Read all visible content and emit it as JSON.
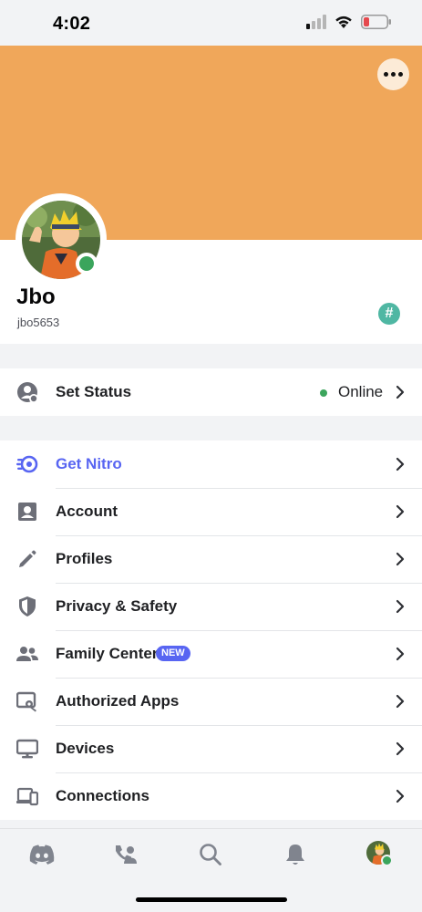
{
  "status_bar": {
    "time": "4:02",
    "icons": [
      "signal-icon",
      "wifi-icon",
      "battery-low-icon"
    ]
  },
  "profile": {
    "banner_color": "#f0a75a",
    "display_name": "Jbo",
    "username": "jbo5653",
    "status_color": "#3ba55c",
    "badge_text": "#",
    "badge_color": "#4fb7a3"
  },
  "status_section": {
    "label": "Set Status",
    "value": "Online",
    "icon": "user-status-icon"
  },
  "settings": [
    {
      "label": "Get Nitro",
      "icon": "nitro-icon",
      "accent": "#5865f2"
    },
    {
      "label": "Account",
      "icon": "account-icon"
    },
    {
      "label": "Profiles",
      "icon": "pencil-icon"
    },
    {
      "label": "Privacy & Safety",
      "icon": "shield-icon"
    },
    {
      "label": "Family Center",
      "icon": "family-icon",
      "badge": "NEW"
    },
    {
      "label": "Authorized Apps",
      "icon": "authorized-apps-icon"
    },
    {
      "label": "Devices",
      "icon": "monitor-icon"
    },
    {
      "label": "Connections",
      "icon": "connections-icon"
    }
  ],
  "tab_bar": {
    "tabs": [
      "home-tab-icon",
      "friends-tab-icon",
      "search-tab-icon",
      "notifications-tab-icon",
      "profile-tab-avatar"
    ]
  }
}
